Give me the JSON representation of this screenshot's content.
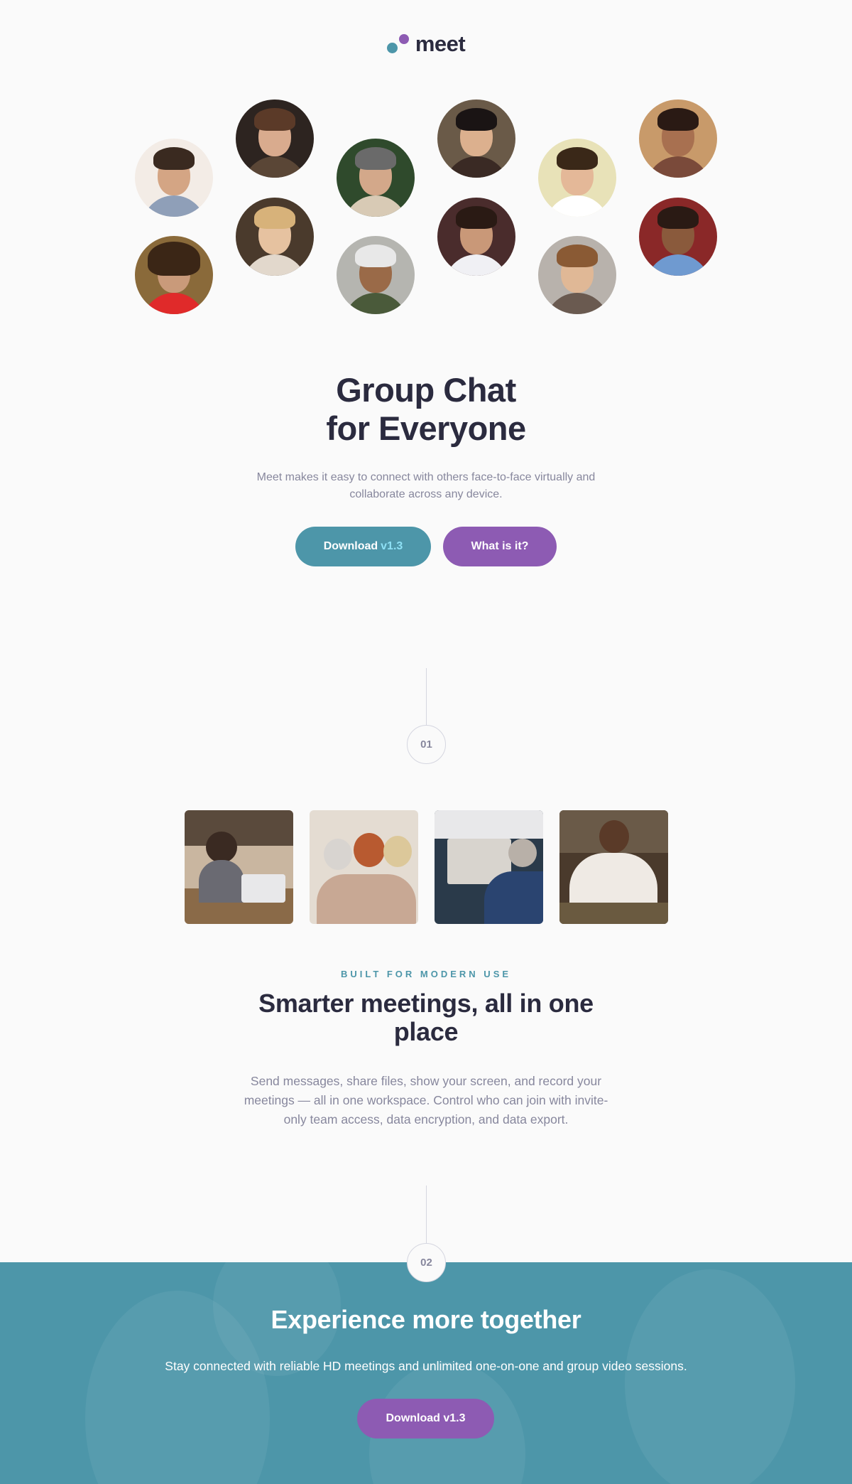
{
  "brand": {
    "name": "meet",
    "colors": {
      "teal": "#4d96a9",
      "purple": "#8d5bb3",
      "dark": "#2b2b3f",
      "muted": "#87879d"
    }
  },
  "hero": {
    "title_line1": "Group Chat",
    "title_line2": "for Everyone",
    "description": "Meet makes it easy to connect with others face-to-face virtually and collaborate across any device.",
    "download_label": "Download",
    "download_version": "v1.3",
    "what_label": "What is it?"
  },
  "steps": {
    "one": "01",
    "two": "02"
  },
  "features": {
    "eyebrow": "BUILT FOR MODERN USE",
    "title": "Smarter meetings, all in one place",
    "description": "Send messages, share files, show your screen, and record your meetings — all in one workspace. Control who can join with invite-only team access, data encryption, and data export."
  },
  "cta": {
    "title": "Experience more together",
    "description": "Stay connected with reliable HD meetings and unlimited one-on-one and group video sessions.",
    "button_label": "Download v1.3"
  }
}
